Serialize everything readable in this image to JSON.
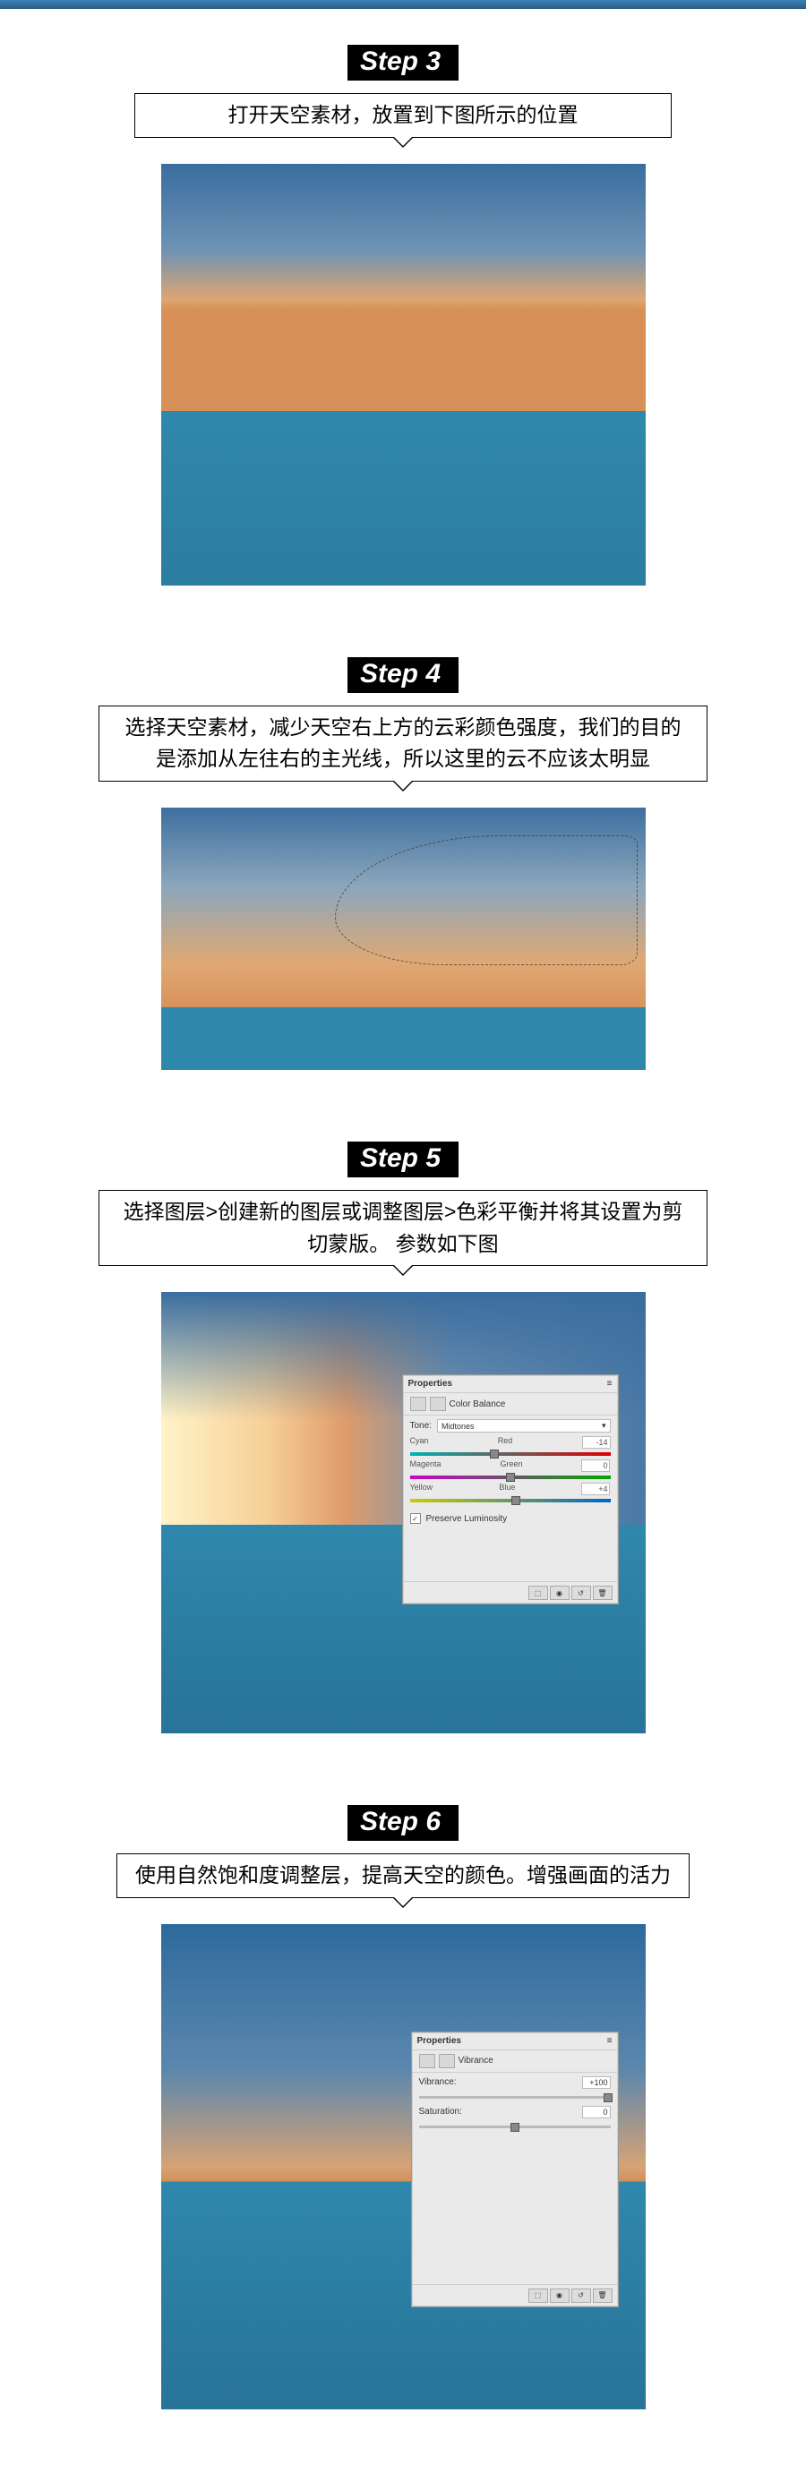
{
  "steps": [
    {
      "badge": "Step 3",
      "desc": "打开天空素材，放置到下图所示的位置"
    },
    {
      "badge": "Step 4",
      "desc": "选择天空素材，减少天空右上方的云彩颜色强度，我们的目的是添加从左往右的主光线，所以这里的云不应该太明显"
    },
    {
      "badge": "Step 5",
      "desc": "选择图层>创建新的图层或调整图层>色彩平衡并将其设置为剪切蒙版。 参数如下图"
    },
    {
      "badge": "Step 6",
      "desc": "使用自然饱和度调整层，提高天空的颜色。增强画面的活力"
    }
  ],
  "panel_cb": {
    "title": "Properties",
    "subtitle": "Color Balance",
    "tone_label": "Tone:",
    "tone_value": "Midtones",
    "rows": [
      {
        "left": "Cyan",
        "right": "Red",
        "value": "-14",
        "knob": 42
      },
      {
        "left": "Magenta",
        "right": "Green",
        "value": "0",
        "knob": 50
      },
      {
        "left": "Yellow",
        "right": "Blue",
        "value": "+4",
        "knob": 53
      }
    ],
    "preserve": "Preserve Luminosity",
    "preserve_checked": "✓"
  },
  "panel_vib": {
    "title": "Properties",
    "subtitle": "Vibrance",
    "rows": [
      {
        "label": "Vibrance:",
        "value": "+100",
        "knob": 99
      },
      {
        "label": "Saturation:",
        "value": "0",
        "knob": 50
      }
    ]
  },
  "icons": {
    "menu": "≡",
    "close_x": "×",
    "chevron": "▾",
    "clip": "⬚",
    "eye": "◉",
    "reset": "↺",
    "trash": "🗑"
  }
}
